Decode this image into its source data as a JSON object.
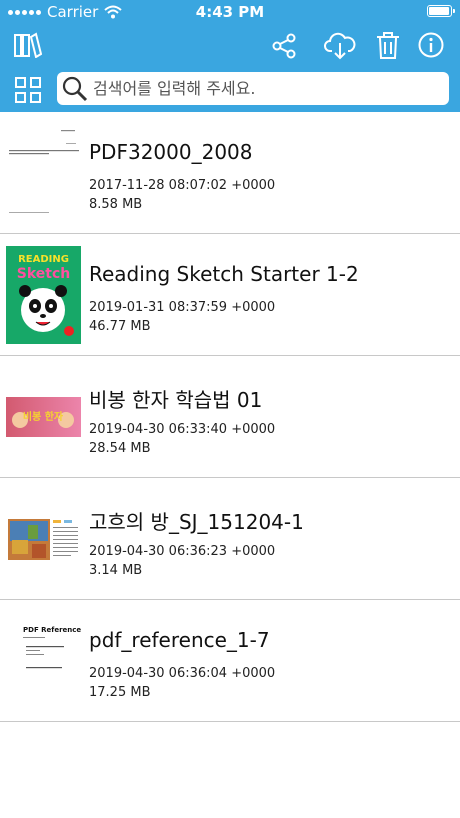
{
  "status": {
    "carrier": "Carrier",
    "time": "4:43 PM",
    "battery_level": 0.95
  },
  "toolbar": {
    "icons": [
      "library-icon",
      "share-icon",
      "cloud-download-icon",
      "trash-icon",
      "info-icon",
      "grid-view-icon"
    ],
    "accent": "#3aa6e0"
  },
  "search": {
    "placeholder": "검색어를 입력해 주세요.",
    "value": ""
  },
  "files": [
    {
      "title": "PDF32000_2008",
      "date": "2017-11-28 08:07:02 +0000",
      "size": "8.58 MB"
    },
    {
      "title": "Reading Sketch Starter 1-2",
      "date": "2019-01-31 08:37:59 +0000",
      "size": "46.77 MB"
    },
    {
      "title": "비봉 한자 학습법 01",
      "date": "2019-04-30 06:33:40 +0000",
      "size": "28.54 MB"
    },
    {
      "title": "고흐의 방_SJ_151204-1",
      "date": "2019-04-30 06:36:23 +0000",
      "size": "3.14 MB"
    },
    {
      "title": "pdf_reference_1-7",
      "date": "2019-04-30 06:36:04 +0000",
      "size": "17.25 MB"
    }
  ],
  "thumbs": {
    "reading_title": "READING",
    "reading_sub": "Sketch",
    "bibong": "비봉 한자",
    "pdfref_title": "PDF Reference"
  }
}
